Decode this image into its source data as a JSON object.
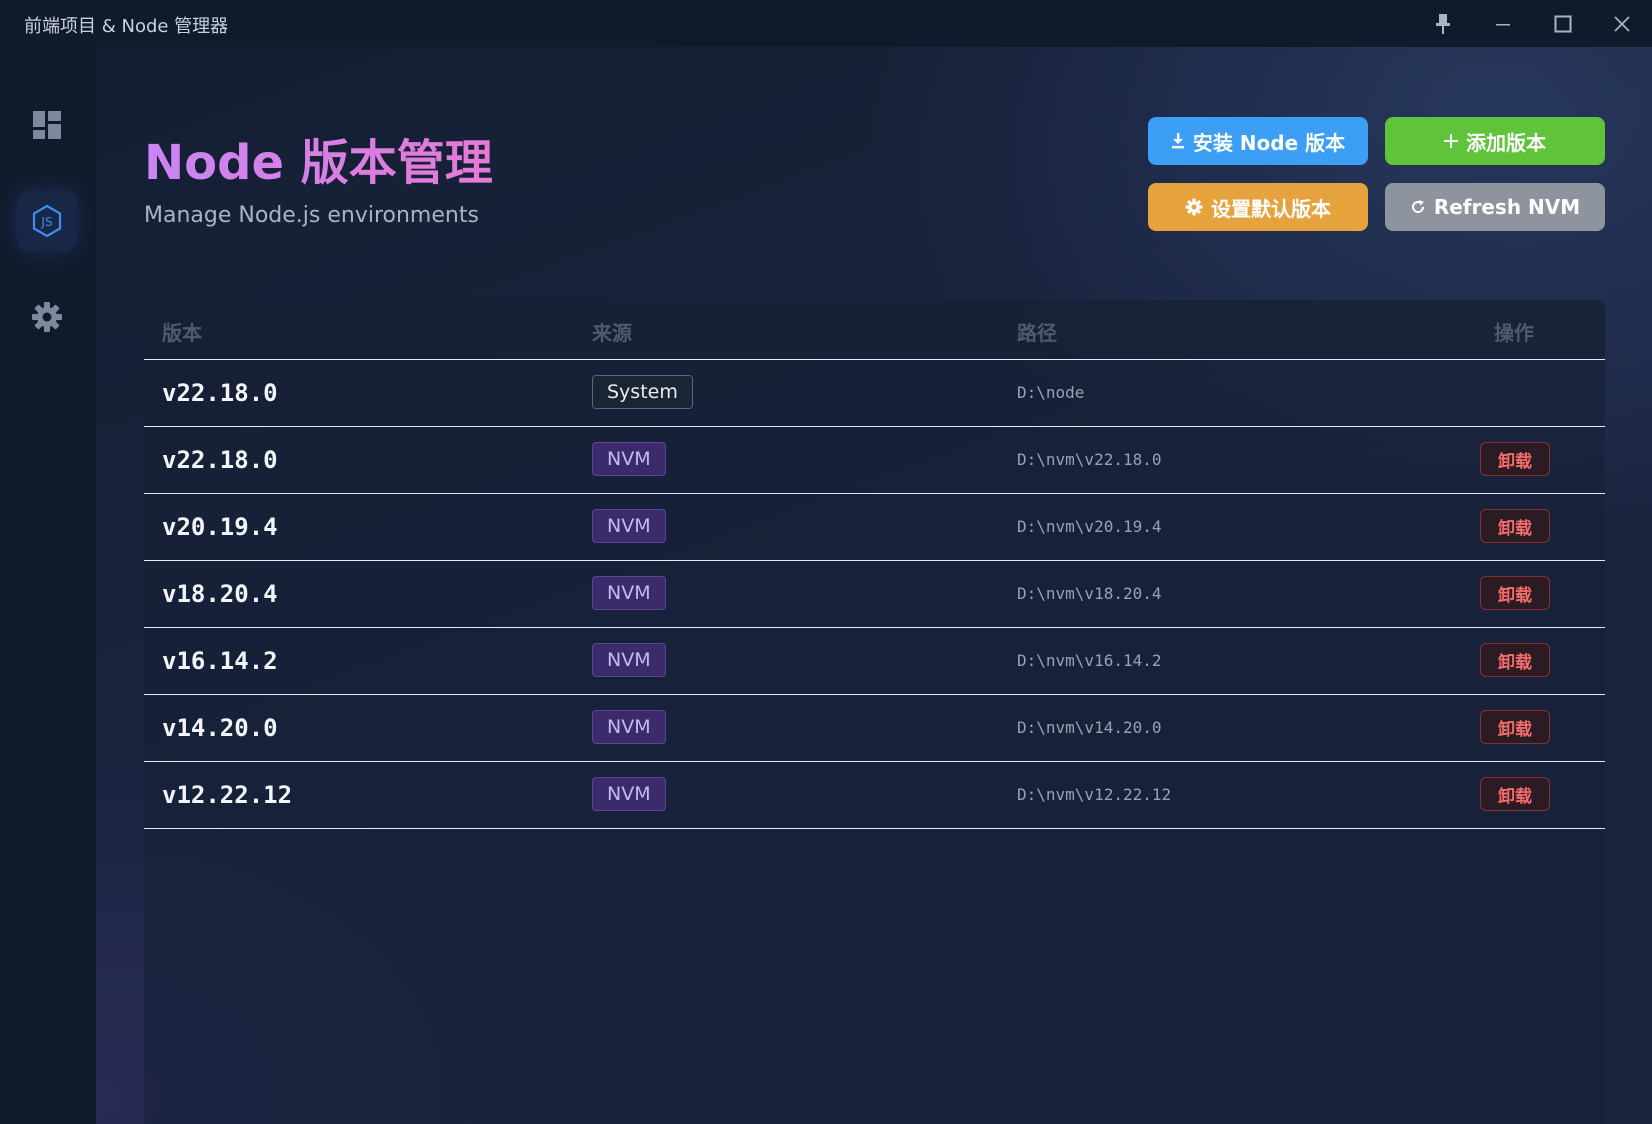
{
  "window": {
    "title": "前端项目 & Node 管理器",
    "controls": [
      "pin-icon",
      "minimize-icon",
      "maximize-icon",
      "close-icon"
    ]
  },
  "sidebar": {
    "items": [
      {
        "name": "dashboard",
        "icon": "dashboard-icon",
        "active": false
      },
      {
        "name": "node",
        "icon": "nodejs-icon",
        "active": true
      },
      {
        "name": "settings",
        "icon": "gear-icon",
        "active": false
      }
    ]
  },
  "header": {
    "title": "Node 版本管理",
    "subtitle": "Manage Node.js environments"
  },
  "actions": {
    "install": {
      "label": "安装 Node 版本",
      "icon": "download-icon",
      "color": "#3d9ef5"
    },
    "add": {
      "label": "添加版本",
      "icon": "plus-icon",
      "color": "#5fc43a"
    },
    "set_default": {
      "label": "设置默认版本",
      "icon": "gear-icon",
      "color": "#e6a23c"
    },
    "refresh": {
      "label": "Refresh NVM",
      "icon": "refresh-icon",
      "color": "#8e949e"
    }
  },
  "table": {
    "columns": [
      "版本",
      "来源",
      "路径",
      "操作"
    ],
    "rows": [
      {
        "version": "v22.18.0",
        "source": "System",
        "path": "D:\\node",
        "action": ""
      },
      {
        "version": "v22.18.0",
        "source": "NVM",
        "path": "D:\\nvm\\v22.18.0",
        "action": "卸载"
      },
      {
        "version": "v20.19.4",
        "source": "NVM",
        "path": "D:\\nvm\\v20.19.4",
        "action": "卸载"
      },
      {
        "version": "v18.20.4",
        "source": "NVM",
        "path": "D:\\nvm\\v18.20.4",
        "action": "卸载"
      },
      {
        "version": "v16.14.2",
        "source": "NVM",
        "path": "D:\\nvm\\v16.14.2",
        "action": "卸载"
      },
      {
        "version": "v14.20.0",
        "source": "NVM",
        "path": "D:\\nvm\\v14.20.0",
        "action": "卸载"
      },
      {
        "version": "v12.22.12",
        "source": "NVM",
        "path": "D:\\nvm\\v12.22.12",
        "action": "卸载"
      }
    ]
  }
}
